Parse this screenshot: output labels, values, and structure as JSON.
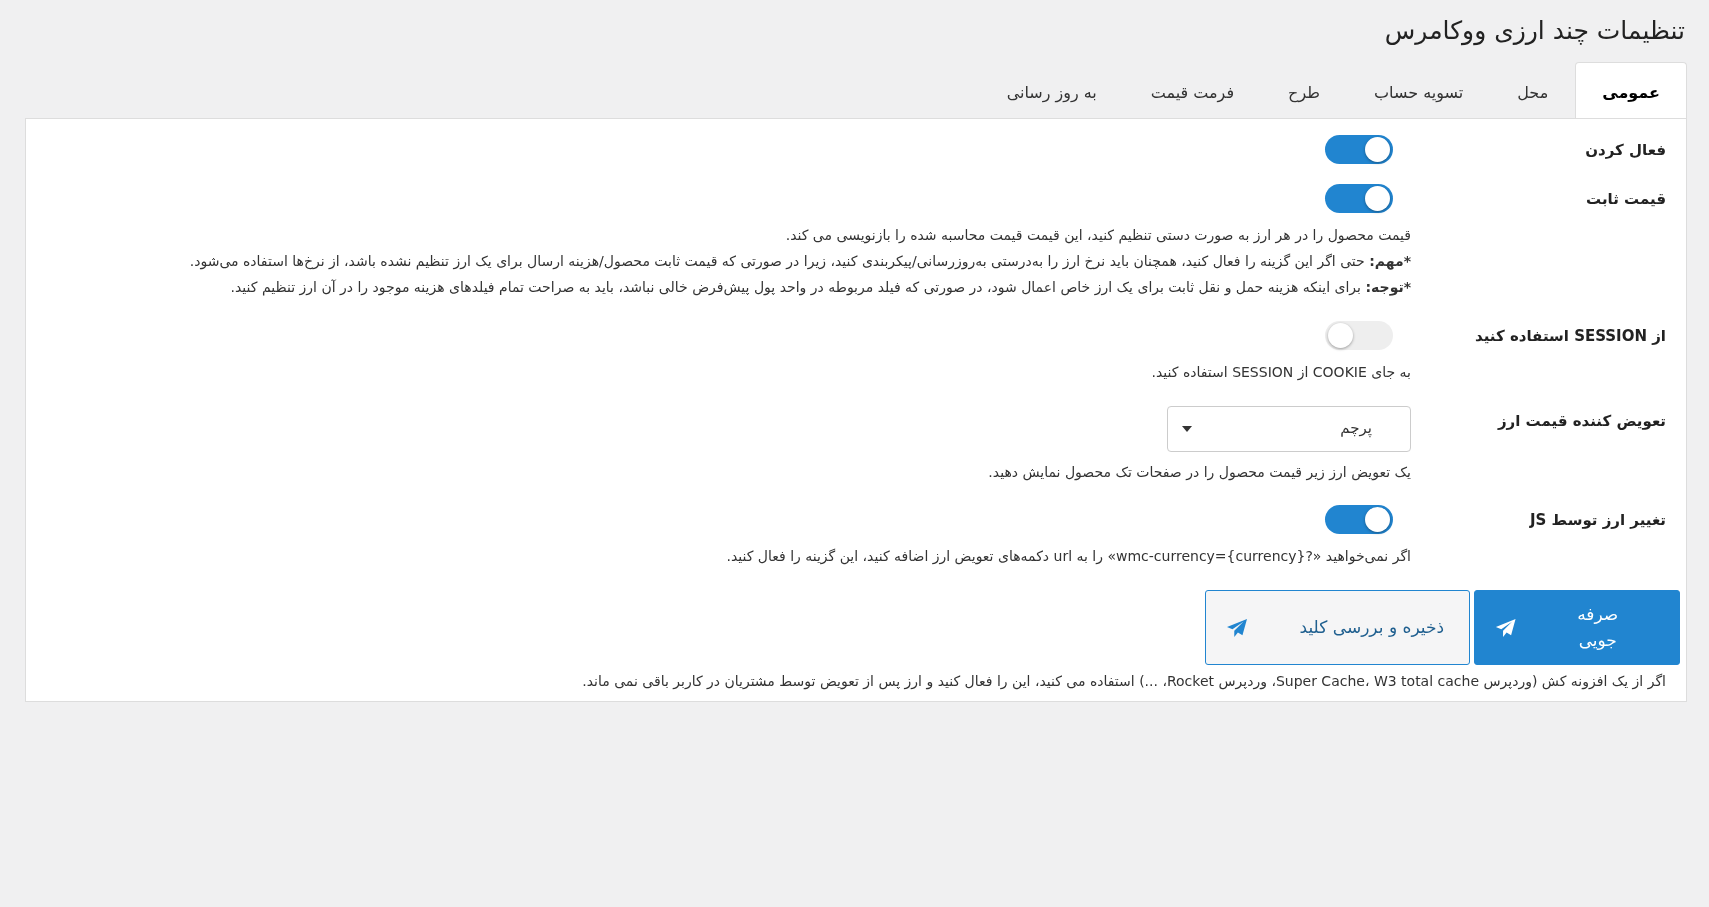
{
  "page": {
    "title": "تنظیمات چند ارزی ووکامرس"
  },
  "tabs": [
    {
      "label": "عمومی",
      "selected": true
    },
    {
      "label": "محل",
      "selected": false
    },
    {
      "label": "تسویه حساب",
      "selected": false
    },
    {
      "label": "طرح",
      "selected": false
    },
    {
      "label": "فرمت قیمت",
      "selected": false
    },
    {
      "label": "به روز رسانی",
      "selected": false
    }
  ],
  "settings": [
    {
      "kind": "toggle",
      "label": "فعال کردن",
      "on": true
    },
    {
      "kind": "toggle",
      "label": "قیمت ثابت",
      "on": true,
      "description": [
        {
          "text": "قیمت محصول را در هر ارز به صورت دستی تنظیم کنید، این قیمت قیمت محاسبه شده را بازنویسی می کند."
        },
        {
          "note": "*مهم:",
          "text": "حتی اگر این گزینه را فعال کنید، همچنان باید نرخ ارز را به‌درستی به‌روزرسانی/پیکربندی کنید، زیرا در صورتی که قیمت ثابت محصول/هزینه ارسال برای یک ارز تنظیم نشده باشد، از نرخ‌ها استفاده می‌شود."
        },
        {
          "note": "*توجه:",
          "text": "برای اینکه هزینه حمل و نقل ثابت برای یک ارز خاص اعمال شود، در صورتی که فیلد مربوطه در واحد پول پیش‌فرض خالی نباشد، باید به صراحت تمام فیلدهای هزینه موجود را در آن ارز تنظیم کنید."
        }
      ]
    },
    {
      "kind": "toggle",
      "label": "از SESSION استفاده کنید",
      "on": false,
      "description": [
        {
          "text": "به جای COOKIE از SESSION استفاده کنید."
        }
      ]
    },
    {
      "kind": "select",
      "label": "تعویض کننده قیمت ارز",
      "value": "پرچم",
      "description": [
        {
          "text": "یک تعویض ارز زیر قیمت محصول را در صفحات تک محصول نمایش دهید."
        }
      ]
    },
    {
      "kind": "toggle",
      "label": "تغییر ارز توسط JS",
      "on": true,
      "description": [
        {
          "text": "اگر نمی‌خواهید «?wmc-currency={currency}» را به url دکمه‌های تعویض ارز اضافه کنید، این گزینه را فعال کنید."
        }
      ]
    }
  ],
  "buttons": [
    {
      "label": "صرفه جویی",
      "kind": "primary"
    },
    {
      "label": "ذخیره و بررسی کلید",
      "kind": "secondary"
    }
  ],
  "footer_note": "اگر از یک افزونه کش (وردپرس Super Cache، W3 total cache، وردپرس Rocket، ...) استفاده می کنید، این را فعال کنید و ارز پس از تعویض توسط مشتریان در کاربر باقی نمی ماند."
}
